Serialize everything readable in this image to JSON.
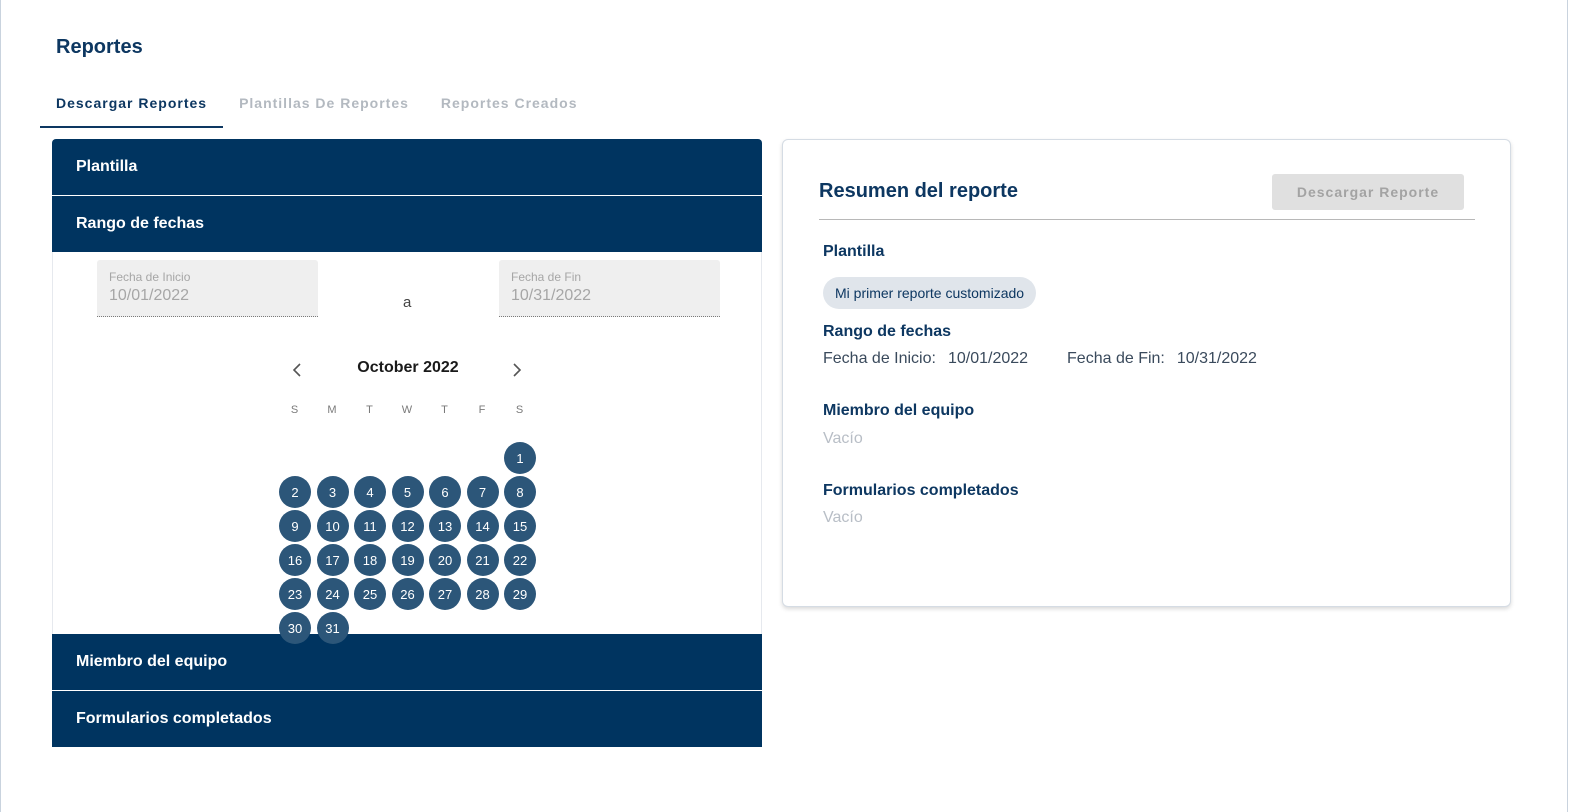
{
  "page": {
    "title": "Reportes"
  },
  "tabs": [
    {
      "label": "Descargar Reportes",
      "active": true
    },
    {
      "label": "Plantillas De Reportes",
      "active": false
    },
    {
      "label": "Reportes Creados",
      "active": false
    }
  ],
  "accordion": {
    "sections": {
      "template": "Plantilla",
      "date_range": "Rango de fechas",
      "team_member": "Miembro del equipo",
      "completed_forms": "Formularios completados"
    },
    "date_range": {
      "start_label": "Fecha de Inicio",
      "start_value": "10/01/2022",
      "separator": "a",
      "end_label": "Fecha de Fin",
      "end_value": "10/31/2022"
    },
    "calendar": {
      "month_label": "October 2022",
      "weekdays": [
        "S",
        "M",
        "T",
        "W",
        "T",
        "F",
        "S"
      ],
      "first_weekday_index": 6,
      "days_in_month": 31,
      "selected_color": "#2c5679"
    }
  },
  "summary": {
    "title": "Resumen del reporte",
    "download_label": "Descargar Reporte",
    "template_label": "Plantilla",
    "template_value": "Mi primer reporte customizado",
    "date_range_label": "Rango de fechas",
    "start_label": "Fecha de Inicio:",
    "start_value": "10/01/2022",
    "end_label": "Fecha de Fin:",
    "end_value": "10/31/2022",
    "team_member_label": "Miembro del equipo",
    "team_member_value": "Vacío",
    "forms_label": "Formularios completados",
    "forms_value": "Vacío"
  },
  "colors": {
    "primary": "#003460",
    "heading": "#0d3761",
    "day_selected": "#2c5679",
    "disabled_button": "#e0e0e0"
  },
  "icons": {
    "prev": "chevron-left-icon",
    "next": "chevron-right-icon"
  }
}
